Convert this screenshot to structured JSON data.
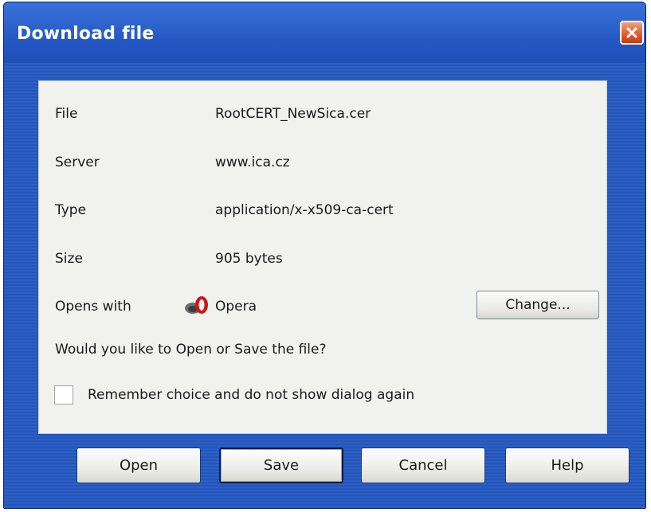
{
  "window": {
    "title": "Download file",
    "close_icon": "close-x-icon"
  },
  "details": [
    {
      "label": "File",
      "value": "RootCERT_NewSica.cer"
    },
    {
      "label": "Server",
      "value": "www.ica.cz"
    },
    {
      "label": "Type",
      "value": "application/x-x509-ca-cert"
    },
    {
      "label": "Size",
      "value": "905 bytes"
    }
  ],
  "opens_with": {
    "label": "Opens with",
    "app": "Opera",
    "icon": "opera-icon",
    "change_label": "Change..."
  },
  "question": "Would you like to Open or Save the file?",
  "remember": {
    "label": "Remember choice and do not show dialog again",
    "checked": false
  },
  "buttons": {
    "open": "Open",
    "save": "Save",
    "cancel": "Cancel",
    "help": "Help"
  },
  "colors": {
    "titlebar": "#2355c2",
    "panel": "#f1f1ee",
    "close_button": "#e05a2f"
  }
}
